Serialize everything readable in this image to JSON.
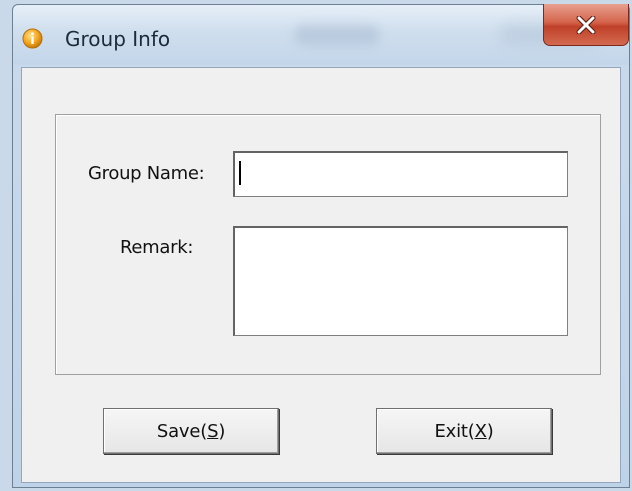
{
  "window": {
    "title": "Group Info",
    "icon": "info-icon",
    "close_glyph": "X"
  },
  "form": {
    "group_name_label": "Group Name:",
    "group_name_value": "",
    "remark_label": "Remark:",
    "remark_value": ""
  },
  "buttons": {
    "save_text": "Save(",
    "save_mnemonic": "S",
    "save_close": ")",
    "exit_text": "Exit(",
    "exit_mnemonic": "X",
    "exit_close": ")"
  },
  "colors": {
    "close_button": "#c7452c",
    "info_icon": "#f5a623",
    "dialog_background": "#f0f0f0"
  }
}
